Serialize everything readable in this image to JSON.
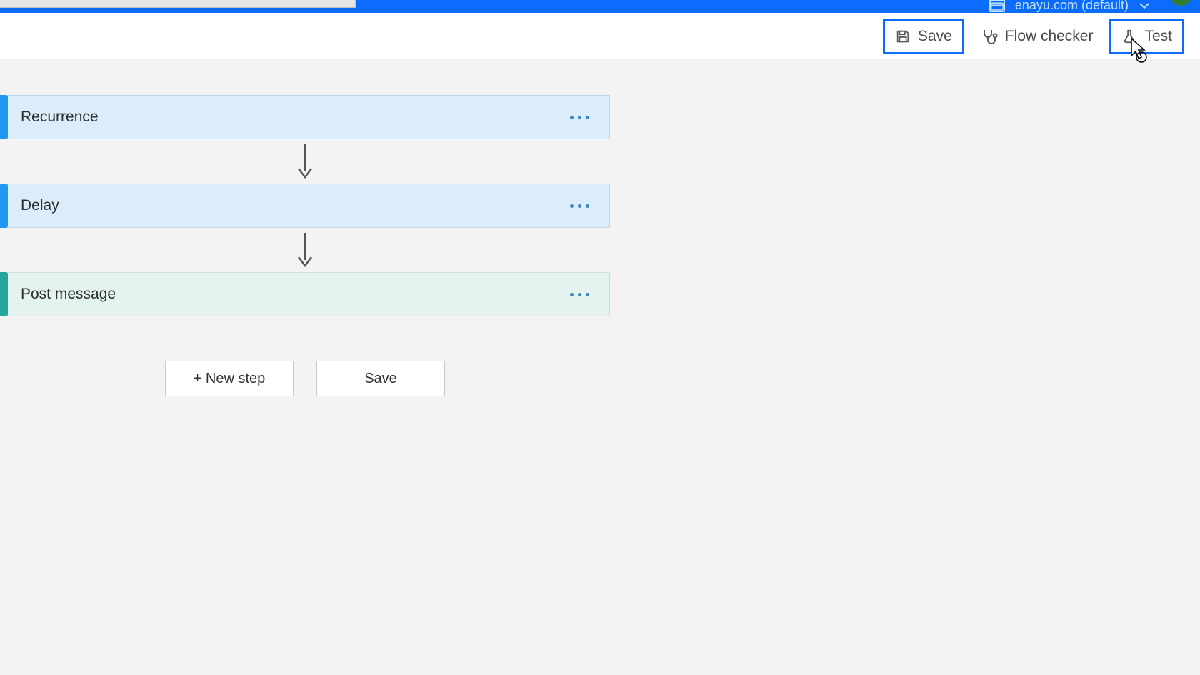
{
  "header": {
    "environment_label": "enayu.com (default)"
  },
  "toolbar": {
    "save_label": "Save",
    "flow_checker_label": "Flow checker",
    "test_label": "Test"
  },
  "flow": {
    "steps": [
      {
        "title": "Recurrence",
        "kind": "recur"
      },
      {
        "title": "Delay",
        "kind": "delay"
      },
      {
        "title": "Post message",
        "kind": "post"
      }
    ]
  },
  "actions": {
    "new_step_label": "+ New step",
    "save_label": "Save"
  }
}
